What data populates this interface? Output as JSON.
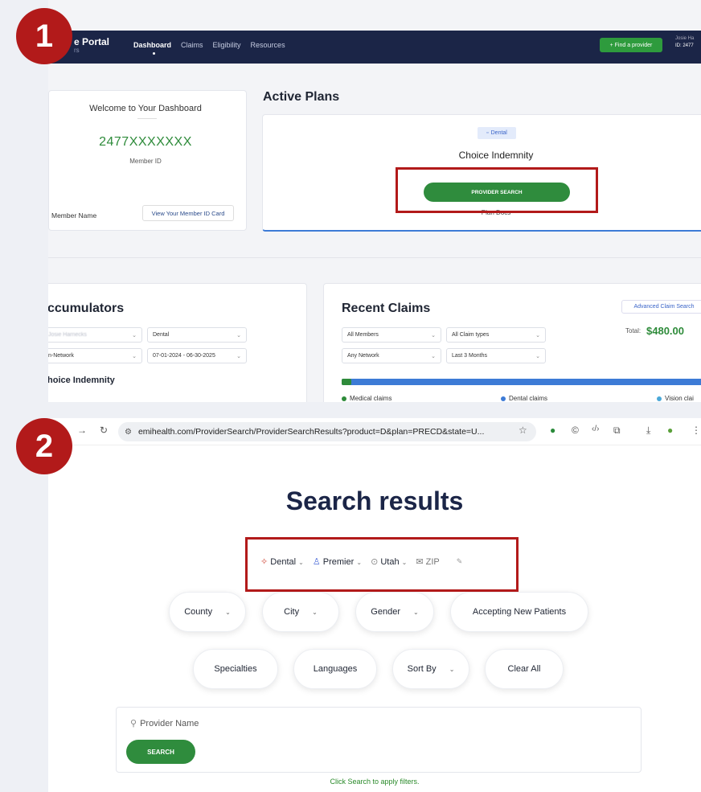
{
  "steps": [
    "1",
    "2"
  ],
  "portal": {
    "nav": {
      "brand": "e Portal",
      "brand_sub": "rs",
      "links": [
        "Dashboard",
        "Claims",
        "Eligibility",
        "Resources"
      ],
      "find_provider": "+ Find a provider",
      "user_name": "Josie Ha",
      "user_id": "ID: 2477"
    },
    "welcome": {
      "title": "Welcome to Your Dashboard",
      "member_id": "2477XXXXXXX",
      "member_id_label": "Member ID",
      "member_name_label": "Member Name",
      "view_card": "View Your Member ID Card"
    },
    "active_plans": {
      "title": "Active Plans",
      "badge": "Dental",
      "plan_name": "Choice Indemnity",
      "provider_search": "PROVIDER SEARCH",
      "plan_docs": "Plan Docs"
    },
    "accumulators": {
      "title": "ccumulators",
      "member_select": "Josie Harnecks",
      "type_select": "Dental",
      "network_select": "n-Network",
      "period_select": "07-01-2024 - 06-30-2025",
      "plan_name": "hoice Indemnity"
    },
    "recent_claims": {
      "title": "Recent Claims",
      "advanced": "Advanced Claim Search",
      "total_label": "Total:",
      "total_value": "$480.00",
      "filters": [
        "All Members",
        "All Claim types",
        "Any Network",
        "Last 3 Months"
      ],
      "legend": [
        "Medical claims",
        "Dental claims",
        "Vision clai"
      ],
      "legend_colors": [
        "#2e8b3a",
        "#3d7bd6",
        "#4aa8d8"
      ]
    }
  },
  "search_page": {
    "url": "emihealth.com/ProviderSearch/ProviderSearchResults?product=D&plan=PRECD&state=U...",
    "title": "Search results",
    "chips": {
      "product": "Dental",
      "plan": "Premier",
      "state": "Utah",
      "zip": "ZIP"
    },
    "filters_row1": [
      "County",
      "City",
      "Gender",
      "Accepting New Patients"
    ],
    "filters_row2": [
      "Specialties",
      "Languages",
      "Sort By",
      "Clear All"
    ],
    "provider_placeholder": "Provider Name",
    "search_button": "SEARCH",
    "hint": "Click Search to apply filters."
  }
}
